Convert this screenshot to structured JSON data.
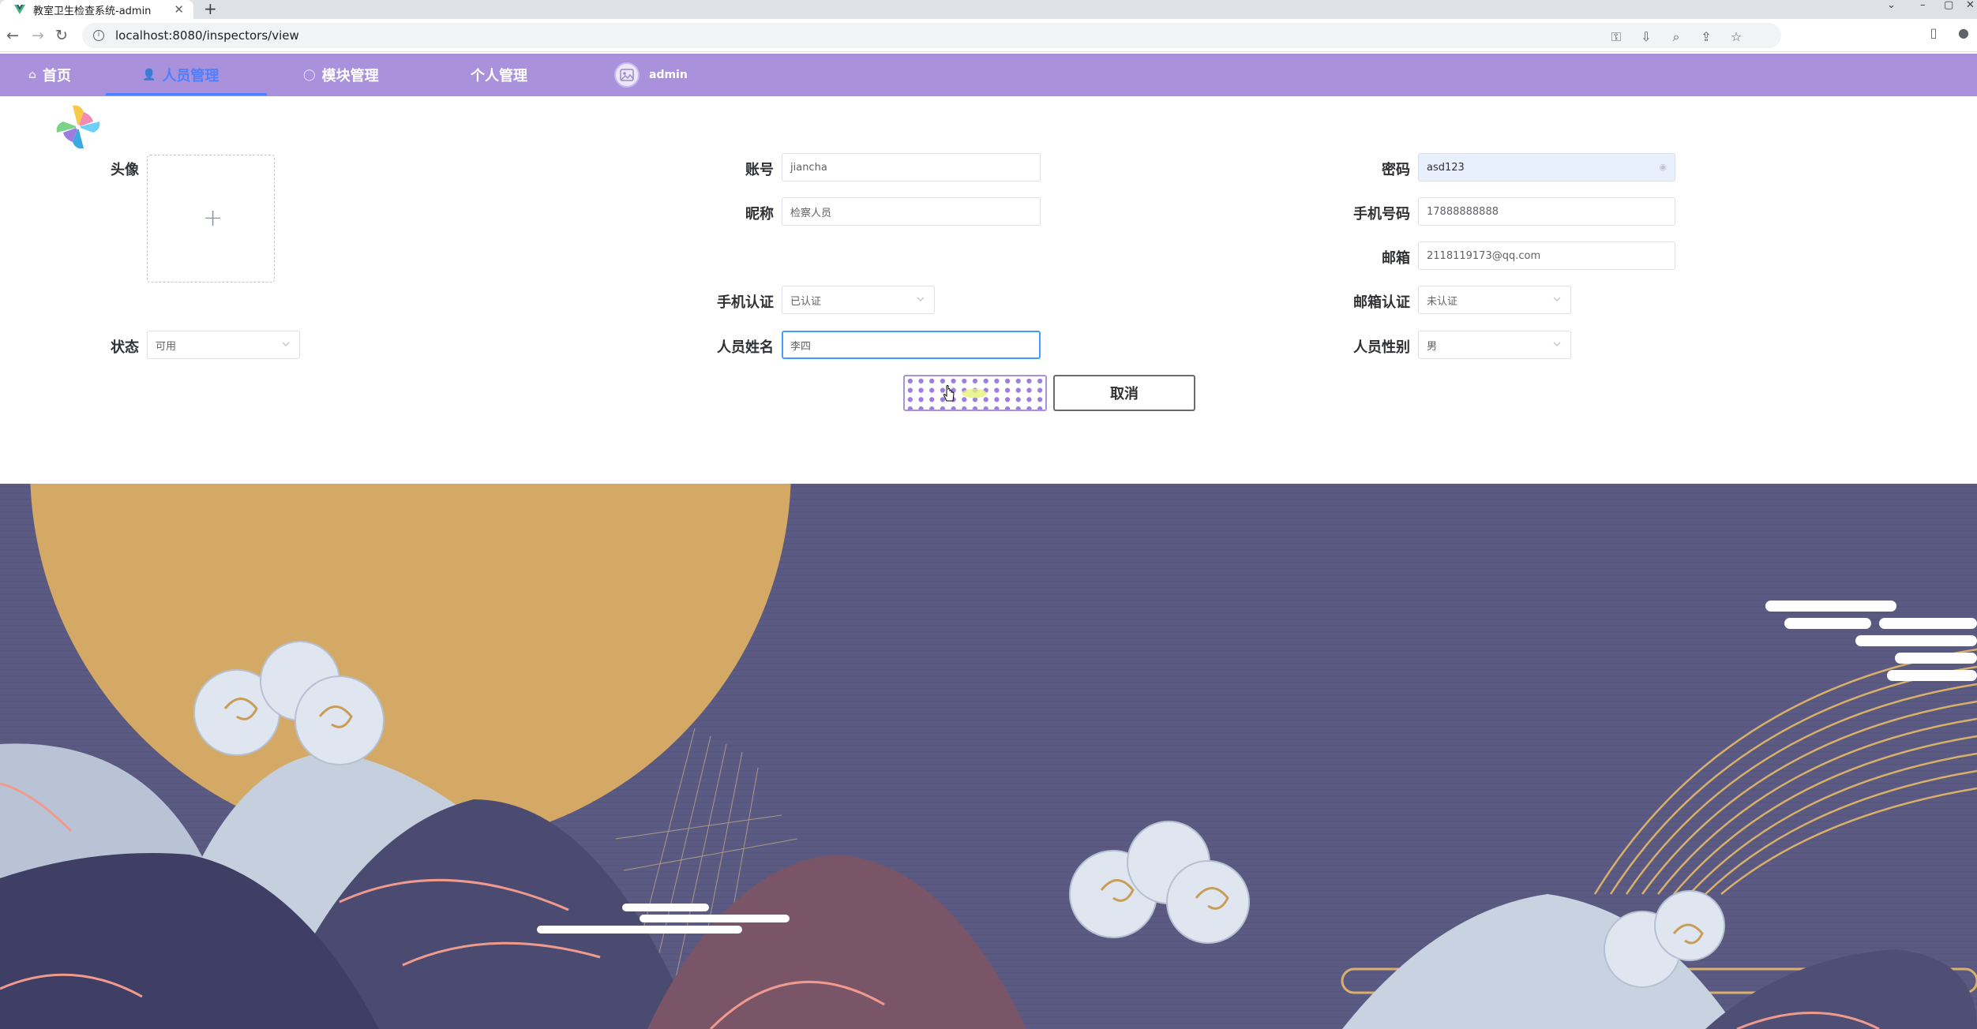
{
  "browser": {
    "tab_title": "教室卫生检查系统-admin",
    "url": "localhost:8080/inspectors/view",
    "new_tab_symbol": "+",
    "close_symbol": "✕",
    "back_symbol": "←",
    "forward_symbol": "→",
    "reload_symbol": "↻"
  },
  "nav": {
    "items": [
      {
        "label": "首页",
        "icon": "home-icon",
        "active": false
      },
      {
        "label": "人员管理",
        "icon": "user-icon",
        "active": true
      },
      {
        "label": "模块管理",
        "icon": "chat-icon",
        "active": false
      },
      {
        "label": "个人管理",
        "icon": "",
        "active": false
      }
    ],
    "user_name": "admin",
    "active_color": "#4e7fff",
    "bar_color": "#a991dc"
  },
  "form": {
    "avatar_label": "头像",
    "avatar_upload_symbol": "+",
    "account_label": "账号",
    "account_value": "jiancha",
    "password_label": "密码",
    "password_value": "asd123",
    "nickname_label": "昵称",
    "nickname_value": "检察人员",
    "phone_label": "手机号码",
    "phone_value": "17888888888",
    "email_label": "邮箱",
    "email_value": "2118119173@qq.com",
    "phone_verify_label": "手机认证",
    "phone_verify_value": "已认证",
    "email_verify_label": "邮箱认证",
    "email_verify_value": "未认证",
    "status_label": "状态",
    "status_value": "可用",
    "name_label": "人员姓名",
    "name_value": "李四",
    "gender_label": "人员性别",
    "gender_value": "男",
    "cancel_label": "取消"
  },
  "colors": {
    "accent": "#a991dc",
    "focus": "#409eff",
    "background_sky": "#5b5a82",
    "moon": "#d4a966"
  }
}
